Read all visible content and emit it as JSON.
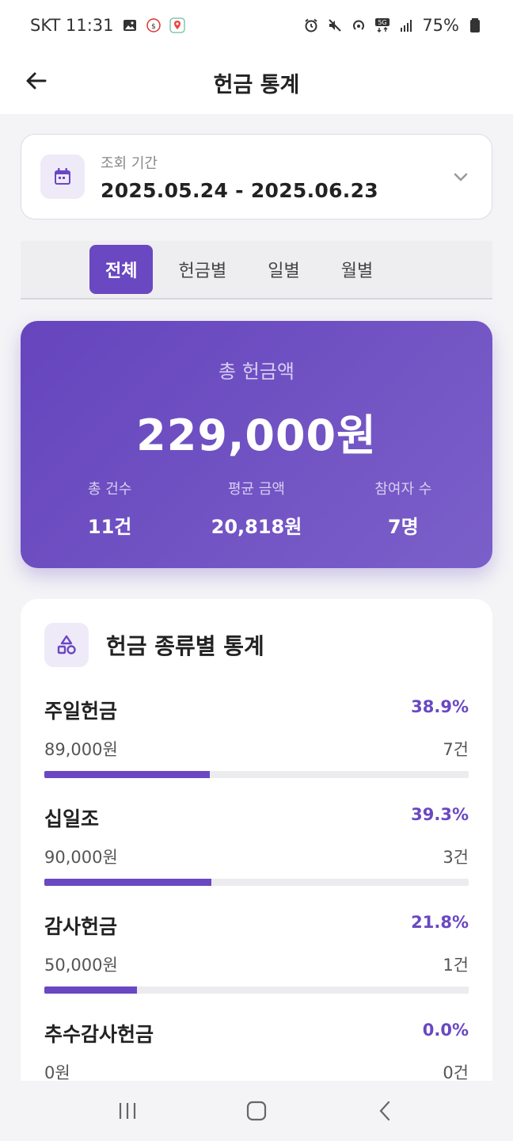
{
  "status_bar": {
    "carrier_time": "SKT 11:31",
    "battery": "75%"
  },
  "header": {
    "title": "헌금 통계"
  },
  "period": {
    "label": "조회 기간",
    "value": "2025.05.24 - 2025.06.23"
  },
  "tabs": [
    {
      "label": "전체",
      "active": true
    },
    {
      "label": "헌금별",
      "active": false
    },
    {
      "label": "일별",
      "active": false
    },
    {
      "label": "월별",
      "active": false
    }
  ],
  "summary": {
    "label": "총 헌금액",
    "amount": "229,000원",
    "stats": [
      {
        "label": "총 건수",
        "value": "11건"
      },
      {
        "label": "평균 금액",
        "value": "20,818원"
      },
      {
        "label": "참여자 수",
        "value": "7명"
      }
    ]
  },
  "type_stats": {
    "title": "헌금 종류별 통계",
    "items": [
      {
        "name": "주일헌금",
        "percent": "38.9%",
        "amount": "89,000원",
        "count": "7건",
        "fraction": 0.389
      },
      {
        "name": "십일조",
        "percent": "39.3%",
        "amount": "90,000원",
        "count": "3건",
        "fraction": 0.393
      },
      {
        "name": "감사헌금",
        "percent": "21.8%",
        "amount": "50,000원",
        "count": "1건",
        "fraction": 0.218
      },
      {
        "name": "추수감사헌금",
        "percent": "0.0%",
        "amount": "0원",
        "count": "0건",
        "fraction": 0.0
      }
    ]
  },
  "colors": {
    "accent": "#6a48c2",
    "summary_gradient_start": "#6645bd",
    "summary_gradient_end": "#7b5fc9"
  }
}
